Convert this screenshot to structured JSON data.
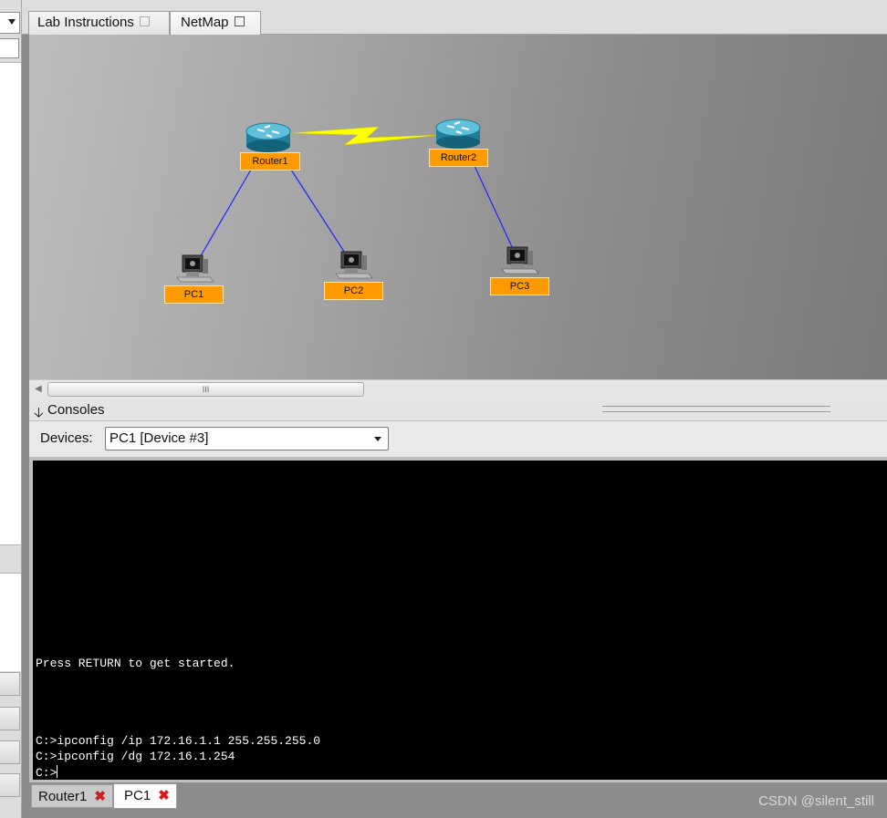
{
  "tabs": [
    {
      "label": "Lab Instructions",
      "icon": "external-link-icon",
      "active": false
    },
    {
      "label": "NetMap",
      "icon": "external-link-icon",
      "active": true
    }
  ],
  "netmap": {
    "devices": [
      {
        "name": "Router1",
        "type": "router-icon"
      },
      {
        "name": "Router2",
        "type": "router-icon"
      },
      {
        "name": "PC1",
        "type": "pc-icon"
      },
      {
        "name": "PC2",
        "type": "pc-icon"
      },
      {
        "name": "PC3",
        "type": "pc-icon"
      }
    ],
    "links": [
      {
        "from": "Router1",
        "to": "Router2",
        "kind": "serial"
      },
      {
        "from": "Router1",
        "to": "PC1",
        "kind": "ethernet"
      },
      {
        "from": "Router1",
        "to": "PC2",
        "kind": "ethernet"
      },
      {
        "from": "Router2",
        "to": "PC3",
        "kind": "ethernet"
      }
    ],
    "colors": {
      "label_bg": "#ff9a00",
      "ethernet": "#2222ff",
      "serial": "#ffff00"
    }
  },
  "scrollbar": {
    "grip": "III"
  },
  "consoles": {
    "title": "Consoles",
    "devices_label": "Devices:",
    "selected_device": "PC1 [Device #3]",
    "lines": [
      "Press RETURN to get started.",
      "C:>ipconfig /ip 172.16.1.1 255.255.255.0",
      "C:>ipconfig /dg 172.16.1.254",
      "C:>"
    ]
  },
  "bottom_tabs": [
    {
      "label": "Router1",
      "active": false
    },
    {
      "label": "PC1",
      "active": true
    }
  ],
  "watermark": "CSDN @silent_still"
}
